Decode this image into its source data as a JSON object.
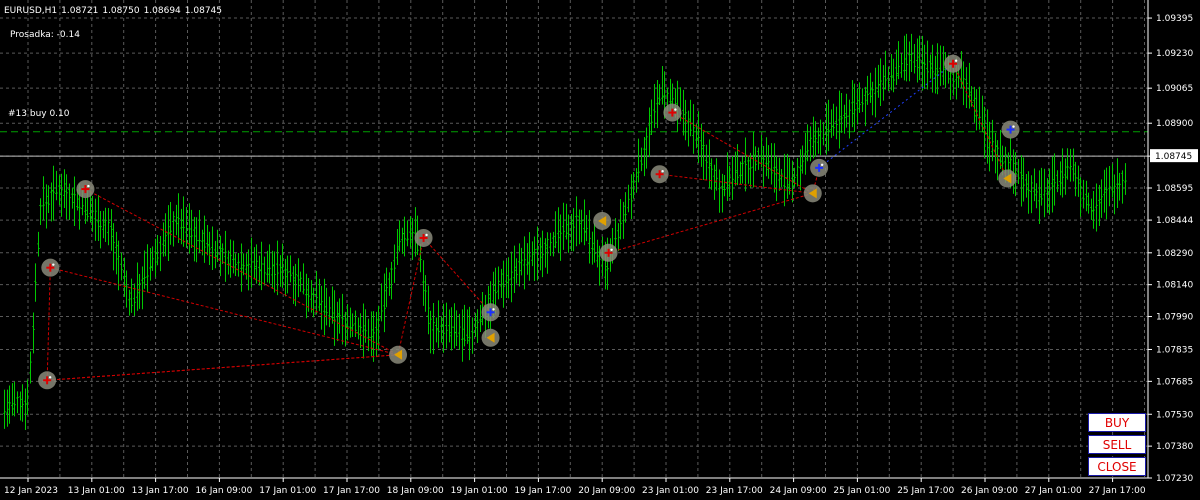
{
  "window": {
    "symbol_timeframe": "EURUSD,H1",
    "ohlc": [
      "1.08721",
      "1.08750",
      "1.08694",
      "1.08745"
    ],
    "drawdown_label": "Prosadka: -0.14",
    "order_line_label": "#13 buy 0.10"
  },
  "buttons": {
    "buy": "BUY",
    "sell": "SELL",
    "close": "CLOSE"
  },
  "colors": {
    "background": "#000000",
    "grid": "#5a5a5a",
    "candle": "#00c800",
    "order_line": "#00a000",
    "bid_line": "#c0c0c0",
    "trade_line": "#d00000",
    "button_text": "#e00000",
    "button_border": "#1a1aa8"
  },
  "chart_data": {
    "type": "candlestick",
    "symbol": "EURUSD",
    "timeframe": "H1",
    "y_ticks": [
      "1.09395",
      "1.09230",
      "1.09065",
      "1.08900",
      "1.08745",
      "1.08595",
      "1.08444",
      "1.08290",
      "1.08140",
      "1.07990",
      "1.07835",
      "1.07685",
      "1.07530",
      "1.07380",
      "1.07230"
    ],
    "current_price": "1.08745",
    "order_price": 1.0886,
    "x_ticks": [
      "12 Jan 2023",
      "13 Jan 01:00",
      "13 Jan 17:00",
      "16 Jan 09:00",
      "17 Jan 01:00",
      "17 Jan 17:00",
      "18 Jan 09:00",
      "19 Jan 01:00",
      "19 Jan 17:00",
      "20 Jan 09:00",
      "23 Jan 01:00",
      "23 Jan 17:00",
      "24 Jan 09:00",
      "25 Jan 01:00",
      "25 Jan 17:00",
      "26 Jan 09:00",
      "27 Jan 01:00",
      "27 Jan 17:00"
    ],
    "ylim": [
      1.0723,
      1.0948
    ],
    "grid": true,
    "trade_markers": [
      {
        "x_tick": "12 Jan 2023",
        "offset": 0.3,
        "price": 1.0769,
        "kind": "buy"
      },
      {
        "x_tick": "12 Jan 2023",
        "offset": 0.35,
        "price": 1.0822,
        "kind": "buy"
      },
      {
        "x_tick": "13 Jan 01:00",
        "offset": -0.1,
        "price": 1.0859,
        "kind": "buy"
      },
      {
        "x_tick": "17 Jan 17:00",
        "offset": 0.8,
        "price": 1.0781,
        "kind": "close"
      },
      {
        "x_tick": "18 Jan 09:00",
        "offset": 0.2,
        "price": 1.0836,
        "kind": "buy"
      },
      {
        "x_tick": "19 Jan 01:00",
        "offset": 0.25,
        "price": 1.0801,
        "kind": "sell"
      },
      {
        "x_tick": "19 Jan 01:00",
        "offset": 0.25,
        "price": 1.0789,
        "kind": "close"
      },
      {
        "x_tick": "20 Jan 09:00",
        "offset": 0.0,
        "price": 1.0844,
        "kind": "close"
      },
      {
        "x_tick": "20 Jan 09:00",
        "offset": 0.1,
        "price": 1.0829,
        "kind": "buy"
      },
      {
        "x_tick": "20 Jan 09:00",
        "offset": 0.9,
        "price": 1.0866,
        "kind": "buy"
      },
      {
        "x_tick": "23 Jan 01:00",
        "offset": 0.1,
        "price": 1.0895,
        "kind": "buy"
      },
      {
        "x_tick": "24 Jan 09:00",
        "offset": 0.3,
        "price": 1.0857,
        "kind": "close"
      },
      {
        "x_tick": "24 Jan 09:00",
        "offset": 0.4,
        "price": 1.0869,
        "kind": "sell"
      },
      {
        "x_tick": "26 Jan 09:00",
        "offset": -0.5,
        "price": 1.0918,
        "kind": "buy"
      },
      {
        "x_tick": "26 Jan 09:00",
        "offset": 0.4,
        "price": 1.0887,
        "kind": "sell"
      },
      {
        "x_tick": "26 Jan 09:00",
        "offset": 0.35,
        "price": 1.0864,
        "kind": "close"
      }
    ]
  }
}
